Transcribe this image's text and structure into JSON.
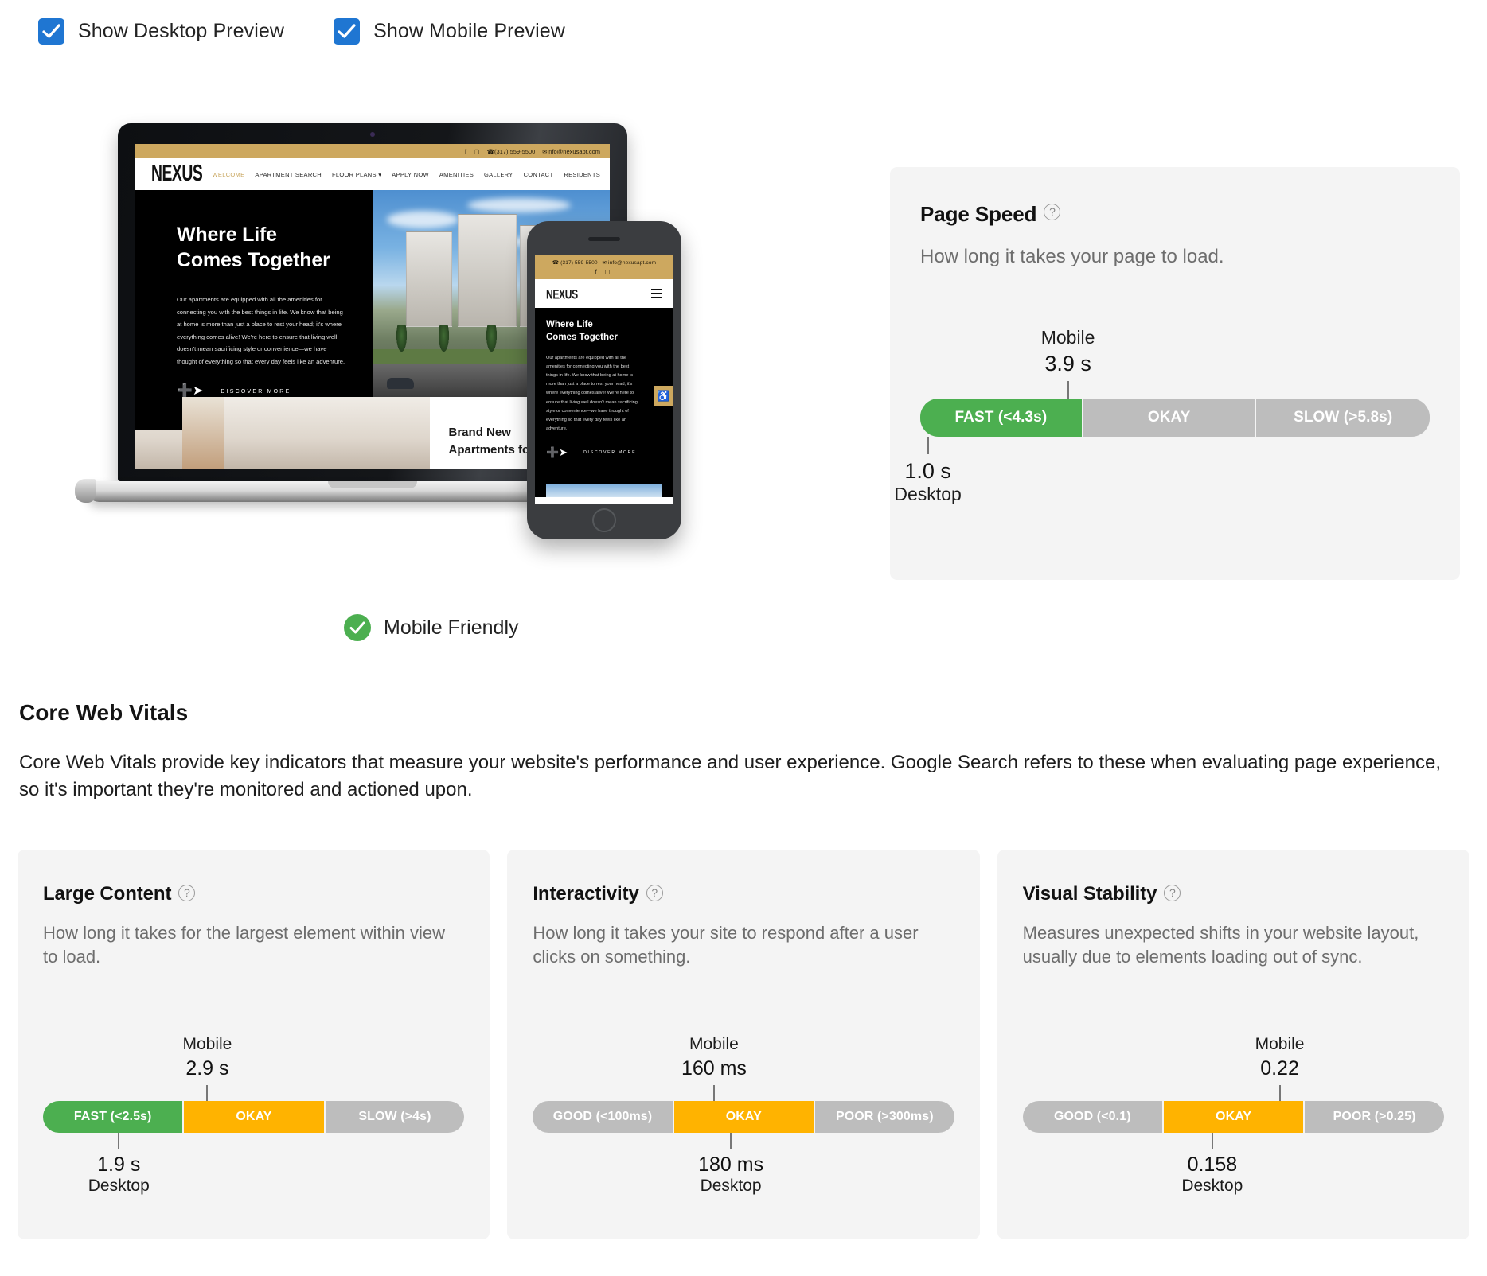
{
  "toggles": [
    {
      "label": "Show Desktop Preview",
      "checked": true
    },
    {
      "label": "Show Mobile Preview",
      "checked": true
    }
  ],
  "preview": {
    "mobile_friendly_label": "Mobile Friendly",
    "site": {
      "brand": "NEXUS",
      "phone": "(317) 559-5500",
      "email": "info@nexusapt.com",
      "nav": [
        "WELCOME",
        "APARTMENT SEARCH",
        "FLOOR PLANS",
        "APPLY NOW",
        "AMENITIES",
        "GALLERY",
        "CONTACT",
        "RESIDENTS"
      ],
      "nav_active": "WELCOME",
      "hero_heading_line1": "Where Life",
      "hero_heading_line2": "Comes Together",
      "hero_paragraph": "Our apartments are equipped with all the amenities for connecting you with the best things in life. We know that being at home is more than just a place to rest your head; it's where everything comes alive! We're here to ensure that living well doesn't mean sacrificing style or convenience—we have thought of everything so that every day feels like an adventure.",
      "cta_label": "DISCOVER MORE",
      "band_line1": "Brand New",
      "band_line2": "Apartments for Rent in"
    },
    "mobile_site": {
      "hero_paragraph": "Our apartments are equipped with all the amenities for connecting you with the best things in life. We know that being at home is more than just a place to rest your head; it's where everything comes alive! We're here to ensure that living well doesn't mean sacrificing style or convenience—we have thought of everything so that every day feels like an adventure."
    }
  },
  "page_speed": {
    "title": "Page Speed",
    "help_icon": "question-circle-icon",
    "description": "How long it takes your page to load."
  },
  "core_web_vitals": {
    "heading": "Core Web Vitals",
    "description": "Core Web Vitals provide key indicators that measure your website's performance and user experience. Google Search refers to these when evaluating page experience, so it's important they're monitored and actioned upon.",
    "cards": [
      {
        "title": "Large Content",
        "description": "How long it takes for the largest element within view to load."
      },
      {
        "title": "Interactivity",
        "description": "How long it takes your site to respond after a user clicks on something."
      },
      {
        "title": "Visual Stability",
        "description": "Measures unexpected shifts in your website layout, usually due to elements loading out of sync."
      }
    ]
  },
  "colors": {
    "good": "#4caf50",
    "okay": "#ffb300",
    "poor": "#bdbdbd",
    "accent": "#1f76d2",
    "card_bg": "#f4f4f4"
  },
  "chart_data": [
    {
      "type": "bar",
      "title": "Page Speed",
      "segments": [
        {
          "label": "FAST (<4.3s)",
          "status": "good",
          "width_pct": 32
        },
        {
          "label": "OKAY",
          "status": "neutral",
          "width_pct": 34
        },
        {
          "label": "SLOW (>5.8s)",
          "status": "neutral",
          "width_pct": 34
        }
      ],
      "markers": [
        {
          "device": "Mobile",
          "value": "3.9 s",
          "position_pct": 29,
          "side": "top"
        },
        {
          "device": "Desktop",
          "value": "1.0 s",
          "position_pct": 1.5,
          "side": "bottom"
        }
      ]
    },
    {
      "type": "bar",
      "title": "Large Content",
      "segments": [
        {
          "label": "FAST (<2.5s)",
          "status": "good",
          "width_pct": 33.5
        },
        {
          "label": "OKAY",
          "status": "okay",
          "width_pct": 33.5
        },
        {
          "label": "SLOW (>4s)",
          "status": "neutral",
          "width_pct": 33
        }
      ],
      "markers": [
        {
          "device": "Mobile",
          "value": "2.9 s",
          "position_pct": 39,
          "side": "top"
        },
        {
          "device": "Desktop",
          "value": "1.9 s",
          "position_pct": 18,
          "side": "bottom"
        }
      ]
    },
    {
      "type": "bar",
      "title": "Interactivity",
      "segments": [
        {
          "label": "GOOD (<100ms)",
          "status": "neutral",
          "width_pct": 33.5
        },
        {
          "label": "OKAY",
          "status": "okay",
          "width_pct": 33.5
        },
        {
          "label": "POOR (>300ms)",
          "status": "neutral",
          "width_pct": 33
        }
      ],
      "markers": [
        {
          "device": "Mobile",
          "value": "160 ms",
          "position_pct": 43,
          "side": "top"
        },
        {
          "device": "Desktop",
          "value": "180 ms",
          "position_pct": 47,
          "side": "bottom"
        }
      ]
    },
    {
      "type": "bar",
      "title": "Visual Stability",
      "segments": [
        {
          "label": "GOOD (<0.1)",
          "status": "neutral",
          "width_pct": 33.5
        },
        {
          "label": "OKAY",
          "status": "okay",
          "width_pct": 33.5
        },
        {
          "label": "POOR (>0.25)",
          "status": "neutral",
          "width_pct": 33
        }
      ],
      "markers": [
        {
          "device": "Mobile",
          "value": "0.22",
          "position_pct": 61,
          "side": "top"
        },
        {
          "device": "Desktop",
          "value": "0.158",
          "position_pct": 45,
          "side": "bottom"
        }
      ]
    }
  ]
}
